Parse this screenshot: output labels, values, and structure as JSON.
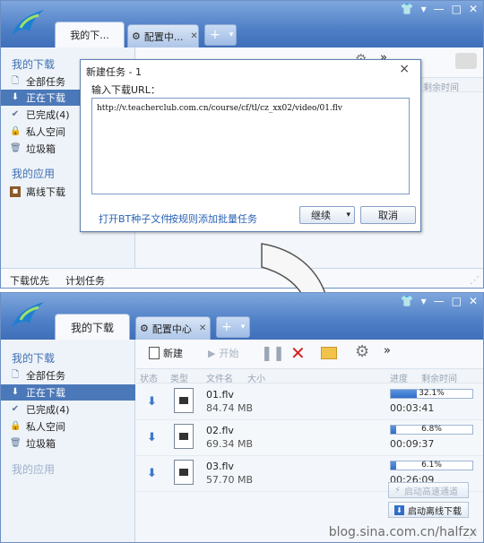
{
  "top_window": {
    "tabs": [
      {
        "label": "我的下...",
        "active": true
      },
      {
        "label": "配置中...",
        "active": false
      }
    ],
    "tab_add_label": "+",
    "sidebar": {
      "section1_title": "我的下载",
      "items": [
        {
          "label": "全部任务",
          "icon": "document-icon"
        },
        {
          "label": "正在下载",
          "icon": "download-arrow-icon",
          "selected": true
        },
        {
          "label": "已完成(4)",
          "icon": "check-icon"
        },
        {
          "label": "私人空间",
          "icon": "lock-icon"
        },
        {
          "label": "垃圾箱",
          "icon": "trash-icon"
        }
      ],
      "section2_title": "我的应用",
      "apps": [
        {
          "label": "离线下载",
          "icon": "offline-download-icon"
        }
      ]
    },
    "toolbar_more": "»",
    "col_partial": "剩余时间",
    "bottom": {
      "priority_label": "下载优先",
      "schedule_label": "计划任务"
    }
  },
  "dialog": {
    "title": "新建任务 - 1",
    "close": "×",
    "url_label": "输入下载URL：",
    "url_value": "http://v.teacherclub.com.cn/course/cf/tl/cz_xx02/video/01.flv",
    "link_bt": "打开BT种子文件",
    "link_batch": "按规则添加批量任务",
    "continue_label": "继续",
    "cancel_label": "取消"
  },
  "bottom_window": {
    "tabs": [
      {
        "label": "我的下载",
        "active": true
      },
      {
        "label": "配置中心",
        "active": false
      }
    ],
    "tab_add_label": "+",
    "sidebar": {
      "section1_title": "我的下载",
      "items": [
        {
          "label": "全部任务",
          "icon": "document-icon"
        },
        {
          "label": "正在下载",
          "icon": "download-arrow-icon",
          "selected": true
        },
        {
          "label": "已完成(4)",
          "icon": "check-icon"
        },
        {
          "label": "私人空间",
          "icon": "lock-icon"
        },
        {
          "label": "垃圾箱",
          "icon": "trash-icon"
        }
      ],
      "section2_title": "我的应用"
    },
    "toolbar": {
      "new_label": "新建",
      "start_label": "开始",
      "more": "»"
    },
    "columns": {
      "status": "状态",
      "type": "类型",
      "filename": "文件名",
      "size": "大小",
      "progress": "进度",
      "remaining": "剩余时间"
    },
    "tasks": [
      {
        "name": "01.flv",
        "size": "84.74 MB",
        "progress_text": "32.1%",
        "progress": 0.321,
        "eta": "00:03:41"
      },
      {
        "name": "02.flv",
        "size": "69.34 MB",
        "progress_text": "6.8%",
        "progress": 0.068,
        "eta": "00:09:37"
      },
      {
        "name": "03.flv",
        "size": "57.70 MB",
        "progress_text": "6.1%",
        "progress": 0.061,
        "eta": "00:26:09"
      }
    ],
    "high_speed_label": "启动高速通道",
    "offline_label": "启动离线下载"
  },
  "watermark": "blog.sina.com.cn/halfzx",
  "colors": {
    "accent": "#4b78b8",
    "link": "#2b63b5",
    "delete": "#d62020"
  }
}
